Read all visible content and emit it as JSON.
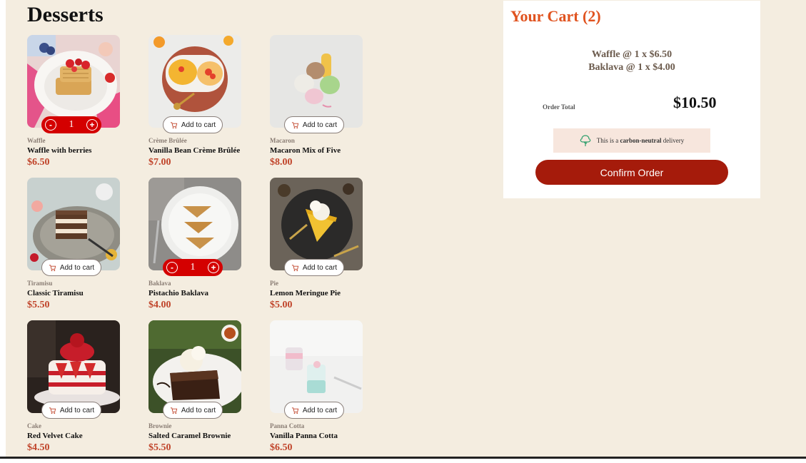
{
  "page": {
    "title": "Desserts"
  },
  "products": [
    {
      "category": "Waffle",
      "name": "Waffle with berries",
      "price": "$6.50",
      "in_cart": true,
      "qty": "1"
    },
    {
      "category": "Crème Brûlée",
      "name": "Vanilla Bean Crème Brûlée",
      "price": "$7.00",
      "in_cart": false
    },
    {
      "category": "Macaron",
      "name": "Macaron Mix of Five",
      "price": "$8.00",
      "in_cart": false
    },
    {
      "category": "Tiramisu",
      "name": "Classic Tiramisu",
      "price": "$5.50",
      "in_cart": false
    },
    {
      "category": "Baklava",
      "name": "Pistachio Baklava",
      "price": "$4.00",
      "in_cart": true,
      "qty": "1"
    },
    {
      "category": "Pie",
      "name": "Lemon Meringue Pie",
      "price": "$5.00",
      "in_cart": false
    },
    {
      "category": "Cake",
      "name": "Red Velvet Cake",
      "price": "$4.50",
      "in_cart": false
    },
    {
      "category": "Brownie",
      "name": "Salted Caramel Brownie",
      "price": "$5.50",
      "in_cart": false
    },
    {
      "category": "Panna Cotta",
      "name": "Vanilla Panna Cotta",
      "price": "$6.50",
      "in_cart": false
    }
  ],
  "buttons": {
    "add_to_cart": "Add to cart",
    "decrement": "-",
    "increment": "+"
  },
  "cart": {
    "title": "Your Cart (2)",
    "lines": [
      "Waffle @ 1 x $6.50",
      "Baklava @ 1 x $4.00"
    ],
    "order_total_label": "Order Total",
    "order_total_value": "$10.50",
    "carbon_prefix": "This is a ",
    "carbon_bold": "carbon-neutral",
    "carbon_suffix": " delivery",
    "confirm_label": "Confirm Order"
  },
  "colors": {
    "accent": "#c0442a",
    "cart_title": "#e0531f",
    "confirm": "#a51b0b",
    "qty_control": "#d40000",
    "background": "#f4ede0"
  },
  "icons": {
    "add_to_cart": "cart-icon",
    "carbon": "tree-icon"
  }
}
